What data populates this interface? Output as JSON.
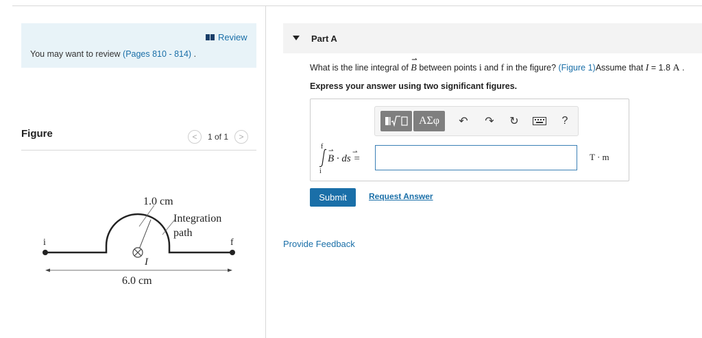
{
  "review": {
    "link_label": "Review",
    "text_prefix": "You may want to review ",
    "pages_link": "(Pages 810 - 814)",
    "text_suffix": " ."
  },
  "figure": {
    "title": "Figure",
    "pager_text": "1 of 1",
    "labels": {
      "radius": "1.0 cm",
      "integration_line1": "Integration",
      "integration_line2": "path",
      "point_i": "i",
      "point_f": "f",
      "current": "I",
      "length": "6.0 cm"
    }
  },
  "part": {
    "title": "Part A",
    "question_a": "What is the line integral of ",
    "vec_B": "B",
    "question_b": " between points ",
    "pt_i": "i",
    "question_c": " and ",
    "pt_f": "f",
    "question_d": " in the figure? ",
    "figure_link": "(Figure 1)",
    "question_e": "Assume that ",
    "var_I": "I",
    "question_f": " = 1.8 ",
    "unit_A": "A",
    "question_g": " .",
    "instruction": "Express your answer using two significant figures."
  },
  "toolbar": {
    "templates_icon": "fraction-sqrt-icon",
    "greek_label": "ΑΣφ",
    "undo_icon": "undo-icon",
    "redo_icon": "redo-icon",
    "reset_icon": "reset-icon",
    "keyboard_icon": "keyboard-icon",
    "help_label": "?"
  },
  "answer": {
    "integral_upper": "f",
    "integral_lower": "i",
    "integrand": "B · ds =",
    "value": "",
    "units": "T · m"
  },
  "actions": {
    "submit_label": "Submit",
    "request_label": "Request Answer",
    "feedback_label": "Provide Feedback"
  },
  "colors": {
    "accent": "#1a6fa8",
    "review_bg": "#e8f3f8",
    "input_border": "#3a7fb5"
  }
}
